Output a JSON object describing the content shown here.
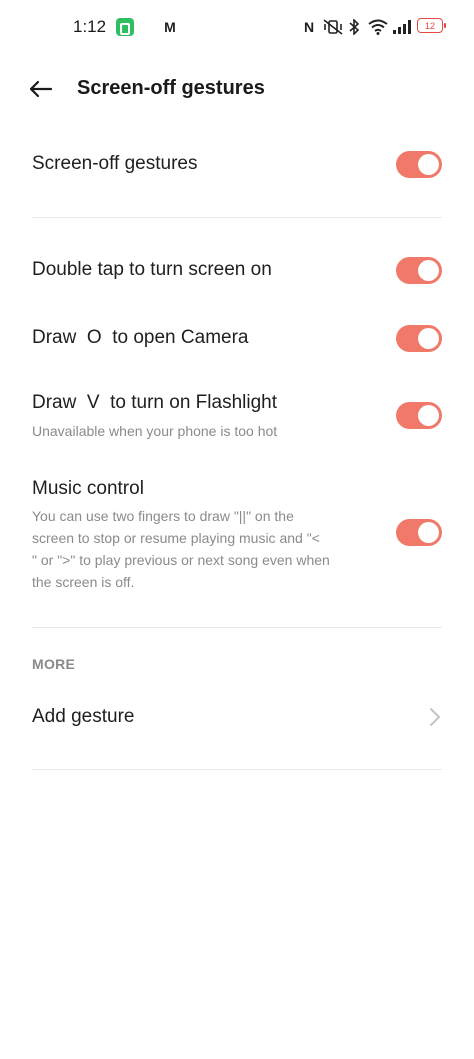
{
  "status_bar": {
    "time": "1:12",
    "icons": [
      "app-notification-icon",
      "mail-icon",
      "nfc-icon",
      "vibrate-icon",
      "bluetooth-icon",
      "wifi-icon",
      "signal-icon"
    ],
    "battery_level": "12"
  },
  "header": {
    "title": "Screen-off gestures",
    "back_icon": "arrow-left-icon"
  },
  "settings": {
    "master": {
      "label": "Screen-off gestures",
      "enabled": true
    },
    "double_tap": {
      "label": "Double tap to turn screen on",
      "enabled": true
    },
    "draw_o": {
      "label": "Draw  O  to open Camera",
      "enabled": true
    },
    "draw_v": {
      "label": "Draw  V  to turn on Flashlight",
      "subtitle": "Unavailable when your phone is too hot",
      "enabled": true
    },
    "music": {
      "label": "Music control",
      "subtitle_lines": [
        "You can use two fingers to draw \"||\" on the",
        "screen to stop or resume playing music and \"<",
        "\" or \">\" to play previous or next song even when",
        "the screen is off."
      ],
      "enabled": true
    }
  },
  "more": {
    "section_label": "MORE",
    "add_gesture_label": "Add gesture"
  },
  "colors": {
    "accent": "#f1796a",
    "text": "#1f1f1f",
    "secondary_text": "#8a8a8a",
    "divider": "#e8e8e8"
  }
}
